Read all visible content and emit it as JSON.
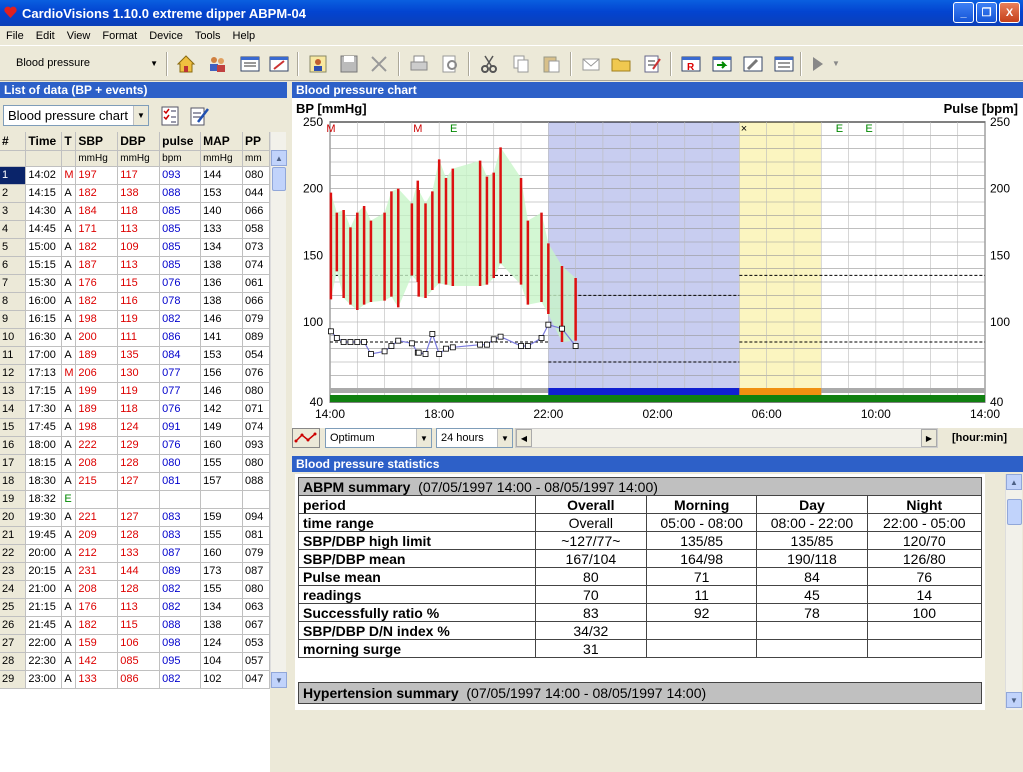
{
  "window": {
    "title": "CardioVisions 1.10.0   extreme dipper ABPM-04",
    "min": "_",
    "max": "❐",
    "close": "X"
  },
  "menu": [
    "File",
    "Edit",
    "View",
    "Format",
    "Device",
    "Tools",
    "Help"
  ],
  "toolbar": {
    "selector_value": "Blood pressure"
  },
  "left": {
    "header": "List of data  (BP + events)",
    "view_select": "Blood pressure chart",
    "columns": [
      "#",
      "Time",
      "T",
      "SBP",
      "DBP",
      "pulse",
      "MAP",
      "PP"
    ],
    "units": [
      "",
      "",
      "",
      "mmHg",
      "mmHg",
      "bpm",
      "mmHg",
      "mm"
    ],
    "rows": [
      [
        "1",
        "14:02",
        "M",
        "197",
        "117",
        "093",
        "144",
        "080"
      ],
      [
        "2",
        "14:15",
        "A",
        "182",
        "138",
        "088",
        "153",
        "044"
      ],
      [
        "3",
        "14:30",
        "A",
        "184",
        "118",
        "085",
        "140",
        "066"
      ],
      [
        "4",
        "14:45",
        "A",
        "171",
        "113",
        "085",
        "133",
        "058"
      ],
      [
        "5",
        "15:00",
        "A",
        "182",
        "109",
        "085",
        "134",
        "073"
      ],
      [
        "6",
        "15:15",
        "A",
        "187",
        "113",
        "085",
        "138",
        "074"
      ],
      [
        "7",
        "15:30",
        "A",
        "176",
        "115",
        "076",
        "136",
        "061"
      ],
      [
        "8",
        "16:00",
        "A",
        "182",
        "116",
        "078",
        "138",
        "066"
      ],
      [
        "9",
        "16:15",
        "A",
        "198",
        "119",
        "082",
        "146",
        "079"
      ],
      [
        "10",
        "16:30",
        "A",
        "200",
        "111",
        "086",
        "141",
        "089"
      ],
      [
        "11",
        "17:00",
        "A",
        "189",
        "135",
        "084",
        "153",
        "054"
      ],
      [
        "12",
        "17:13",
        "M",
        "206",
        "130",
        "077",
        "156",
        "076"
      ],
      [
        "13",
        "17:15",
        "A",
        "199",
        "119",
        "077",
        "146",
        "080"
      ],
      [
        "14",
        "17:30",
        "A",
        "189",
        "118",
        "076",
        "142",
        "071"
      ],
      [
        "15",
        "17:45",
        "A",
        "198",
        "124",
        "091",
        "149",
        "074"
      ],
      [
        "16",
        "18:00",
        "A",
        "222",
        "129",
        "076",
        "160",
        "093"
      ],
      [
        "17",
        "18:15",
        "A",
        "208",
        "128",
        "080",
        "155",
        "080"
      ],
      [
        "18",
        "18:30",
        "A",
        "215",
        "127",
        "081",
        "157",
        "088"
      ],
      [
        "19",
        "18:32",
        "E",
        "",
        "",
        "",
        "",
        ""
      ],
      [
        "20",
        "19:30",
        "A",
        "221",
        "127",
        "083",
        "159",
        "094"
      ],
      [
        "21",
        "19:45",
        "A",
        "209",
        "128",
        "083",
        "155",
        "081"
      ],
      [
        "22",
        "20:00",
        "A",
        "212",
        "133",
        "087",
        "160",
        "079"
      ],
      [
        "23",
        "20:15",
        "A",
        "231",
        "144",
        "089",
        "173",
        "087"
      ],
      [
        "24",
        "21:00",
        "A",
        "208",
        "128",
        "082",
        "155",
        "080"
      ],
      [
        "25",
        "21:15",
        "A",
        "176",
        "113",
        "082",
        "134",
        "063"
      ],
      [
        "26",
        "21:45",
        "A",
        "182",
        "115",
        "088",
        "138",
        "067"
      ],
      [
        "27",
        "22:00",
        "A",
        "159",
        "106",
        "098",
        "124",
        "053"
      ],
      [
        "28",
        "22:30",
        "A",
        "142",
        "085",
        "095",
        "104",
        "057"
      ],
      [
        "29",
        "23:00",
        "A",
        "133",
        "086",
        "082",
        "102",
        "047"
      ]
    ]
  },
  "chart": {
    "header": "Blood pressure chart",
    "left_label": "BP [mmHg]",
    "right_label": "Pulse [bpm]",
    "yticks": [
      "250",
      "200",
      "150",
      "100",
      "40"
    ],
    "xticks": [
      "14:00",
      "18:00",
      "22:00",
      "02:00",
      "06:00",
      "10:00",
      "14:00"
    ],
    "xunit": "[hour:min]",
    "event_markers": [
      "M",
      "M",
      "E",
      "×",
      "E",
      "E"
    ],
    "scheme_select": "Optimum",
    "range_select": "24 hours",
    "colors": {
      "sbp_bar": "#dd1111",
      "pulse_line": "#7a7add",
      "night_band": "#c8cdf0",
      "morning_band": "#fbf5c0",
      "fill": "#c8f5c8"
    }
  },
  "chart_data": {
    "type": "bar",
    "title": "Blood pressure chart",
    "ylabel": "BP [mmHg]",
    "y2label": "Pulse [bpm]",
    "ylim": [
      40,
      250
    ],
    "xlim": [
      "14:00",
      "14:00"
    ],
    "series": [
      {
        "name": "SBP",
        "x": [
          "14:02",
          "14:15",
          "14:30",
          "14:45",
          "15:00",
          "15:15",
          "15:30",
          "16:00",
          "16:15",
          "16:30",
          "17:00",
          "17:13",
          "17:15",
          "17:30",
          "17:45",
          "18:00",
          "18:15",
          "18:30",
          "19:30",
          "19:45",
          "20:00",
          "20:15",
          "21:00",
          "21:15",
          "21:45",
          "22:00",
          "22:30",
          "23:00"
        ],
        "values": [
          197,
          182,
          184,
          171,
          182,
          187,
          176,
          182,
          198,
          200,
          189,
          206,
          199,
          189,
          198,
          222,
          208,
          215,
          221,
          209,
          212,
          231,
          208,
          176,
          182,
          159,
          142,
          133
        ]
      },
      {
        "name": "DBP",
        "x": [
          "14:02",
          "14:15",
          "14:30",
          "14:45",
          "15:00",
          "15:15",
          "15:30",
          "16:00",
          "16:15",
          "16:30",
          "17:00",
          "17:13",
          "17:15",
          "17:30",
          "17:45",
          "18:00",
          "18:15",
          "18:30",
          "19:30",
          "19:45",
          "20:00",
          "20:15",
          "21:00",
          "21:15",
          "21:45",
          "22:00",
          "22:30",
          "23:00"
        ],
        "values": [
          117,
          138,
          118,
          113,
          109,
          113,
          115,
          116,
          119,
          111,
          135,
          130,
          119,
          118,
          124,
          129,
          128,
          127,
          127,
          128,
          133,
          144,
          128,
          113,
          115,
          106,
          85,
          86
        ]
      },
      {
        "name": "pulse",
        "x": [
          "14:02",
          "14:15",
          "14:30",
          "14:45",
          "15:00",
          "15:15",
          "15:30",
          "16:00",
          "16:15",
          "16:30",
          "17:00",
          "17:13",
          "17:15",
          "17:30",
          "17:45",
          "18:00",
          "18:15",
          "18:30",
          "19:30",
          "19:45",
          "20:00",
          "20:15",
          "21:00",
          "21:15",
          "21:45",
          "22:00",
          "22:30",
          "23:00"
        ],
        "values": [
          93,
          88,
          85,
          85,
          85,
          85,
          76,
          78,
          82,
          86,
          84,
          77,
          77,
          76,
          91,
          76,
          80,
          81,
          83,
          83,
          87,
          89,
          82,
          82,
          88,
          98,
          95,
          82
        ]
      }
    ]
  },
  "stats": {
    "header": "Blood pressure statistics",
    "abpm_title": "ABPM summary",
    "abpm_range": "(07/05/1997 14:00 - 08/05/1997 14:00)",
    "cols": [
      "period",
      "Overall",
      "Morning",
      "Day",
      "Night"
    ],
    "rows": [
      [
        "time range",
        "Overall",
        "05:00 - 08:00",
        "08:00 - 22:00",
        "22:00 - 05:00"
      ],
      [
        "SBP/DBP high limit",
        "~127/77~",
        "135/85",
        "135/85",
        "120/70"
      ],
      [
        "SBP/DBP mean",
        "167/104",
        "164/98",
        "190/118",
        "126/80"
      ],
      [
        "Pulse mean",
        "80",
        "71",
        "84",
        "76"
      ],
      [
        "readings",
        "70",
        "11",
        "45",
        "14"
      ],
      [
        "Successfully ratio %",
        "83",
        "92",
        "78",
        "100"
      ],
      [
        "SBP/DBP D/N index %",
        "34/32",
        "",
        "",
        ""
      ],
      [
        "morning surge",
        "31",
        "",
        "",
        ""
      ]
    ],
    "hyper_title": "Hypertension summary",
    "hyper_range": "(07/05/1997 14:00 - 08/05/1997 14:00)"
  }
}
